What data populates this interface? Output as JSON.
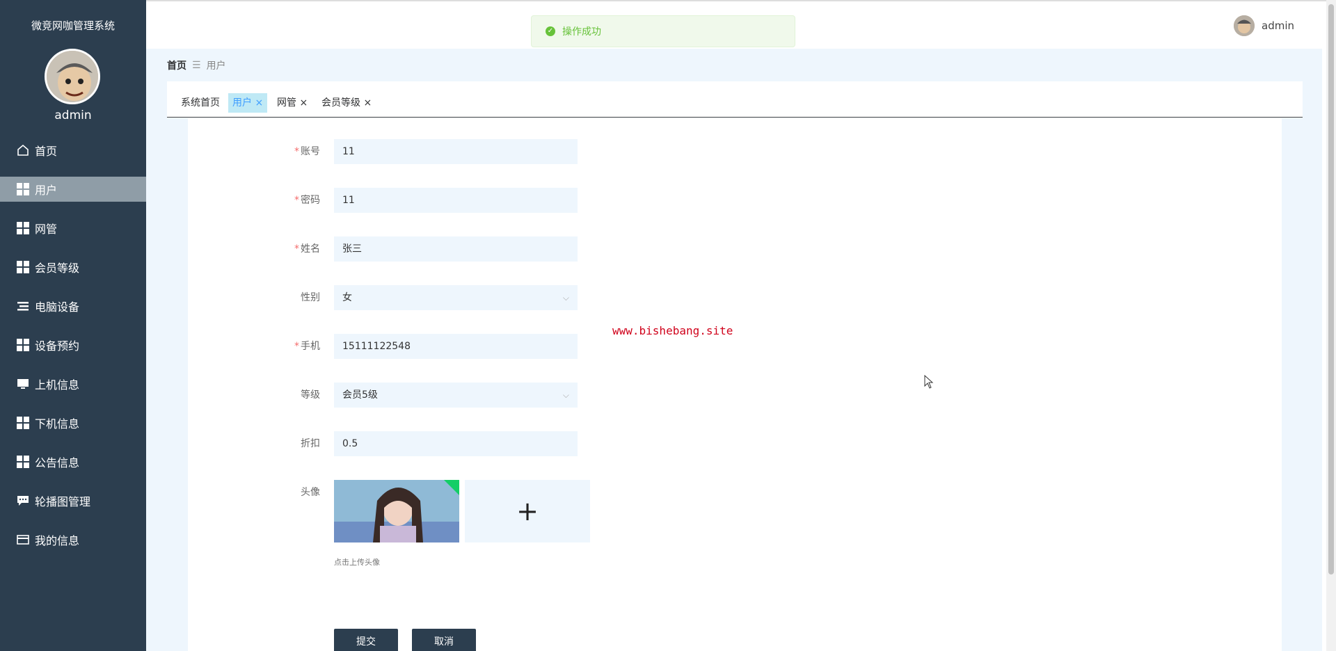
{
  "sidebar": {
    "system_title": "微竞网咖管理系统",
    "username": "admin",
    "items": [
      {
        "label": "首页",
        "icon": "home-icon"
      },
      {
        "label": "用户",
        "icon": "grid-icon"
      },
      {
        "label": "网管",
        "icon": "grid-icon"
      },
      {
        "label": "会员等级",
        "icon": "grid-icon"
      },
      {
        "label": "电脑设备",
        "icon": "list-icon"
      },
      {
        "label": "设备预约",
        "icon": "grid-icon"
      },
      {
        "label": "上机信息",
        "icon": "monitor-icon"
      },
      {
        "label": "下机信息",
        "icon": "grid-icon"
      },
      {
        "label": "公告信息",
        "icon": "grid-icon"
      },
      {
        "label": "轮播图管理",
        "icon": "chat-icon"
      },
      {
        "label": "我的信息",
        "icon": "card-icon"
      }
    ],
    "active_index": 1
  },
  "header": {
    "username": "admin",
    "toast": "操作成功"
  },
  "breadcrumb": {
    "home": "首页",
    "current": "用户"
  },
  "tabs": [
    {
      "label": "系统首页",
      "closable": false
    },
    {
      "label": "用户",
      "closable": true,
      "active": true
    },
    {
      "label": "网管",
      "closable": true
    },
    {
      "label": "会员等级",
      "closable": true
    }
  ],
  "form": {
    "account": {
      "label": "账号",
      "value": "11",
      "required": true
    },
    "password": {
      "label": "密码",
      "value": "11",
      "required": true
    },
    "name": {
      "label": "姓名",
      "value": "张三",
      "required": true
    },
    "gender": {
      "label": "性别",
      "value": "女",
      "required": false
    },
    "phone": {
      "label": "手机",
      "value": "15111122548",
      "required": true
    },
    "level": {
      "label": "等级",
      "value": "会员5级",
      "required": false
    },
    "discount": {
      "label": "折扣",
      "value": "0.5",
      "required": false
    },
    "avatar": {
      "label": "头像",
      "tip": "点击上传头像"
    }
  },
  "buttons": {
    "submit": "提交",
    "cancel": "取消"
  },
  "watermark": "www.bishebang.site",
  "colors": {
    "sidebar_bg": "#2c3e4f",
    "active_menu": "#8f9da7",
    "main_bg": "#eef6fd",
    "success": "#67c23a",
    "watermark": "#d0021b"
  }
}
